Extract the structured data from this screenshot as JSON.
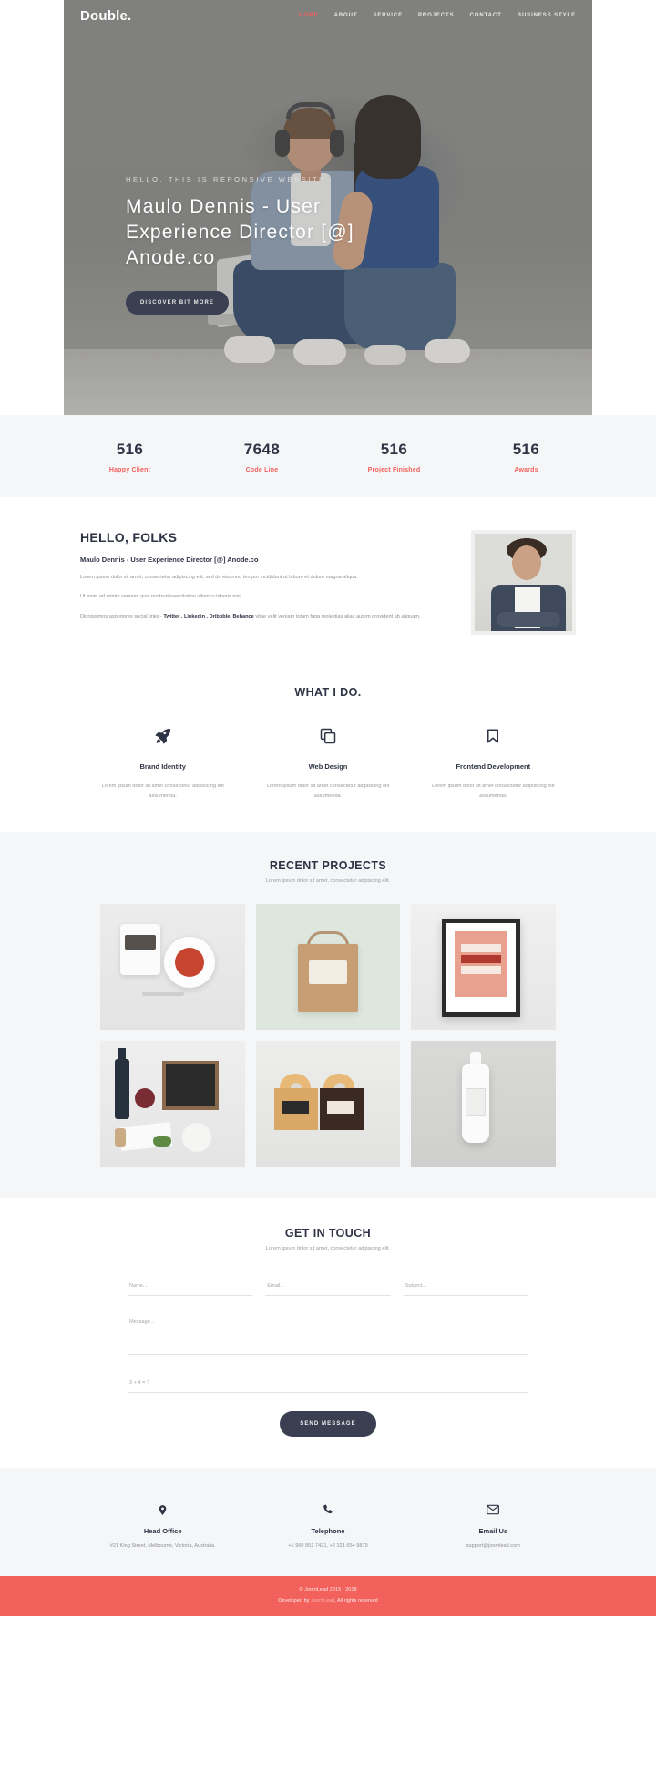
{
  "header": {
    "brand": "Double.",
    "nav": [
      {
        "label": "HOME",
        "active": true
      },
      {
        "label": "ABOUT",
        "active": false
      },
      {
        "label": "SERVICE",
        "active": false
      },
      {
        "label": "PROJECTS",
        "active": false
      },
      {
        "label": "CONTACT",
        "active": false
      },
      {
        "label": "BUSINESS STYLE",
        "active": false
      }
    ],
    "accent_color": "#f2615c",
    "nav_color": "#e9e9e9"
  },
  "hero": {
    "kicker": "HELLO, THIS IS REPONSIVE WEBSITE",
    "title": "Maulo Dennis - User Experience Director [@] Anode.co",
    "button": "DISCOVER BIT MORE"
  },
  "stats": {
    "items": [
      {
        "number": "516",
        "label": "Happy Client"
      },
      {
        "number": "7648",
        "label": "Code Line"
      },
      {
        "number": "516",
        "label": "Project Finished"
      },
      {
        "number": "516",
        "label": "Awards"
      }
    ],
    "label_color": "#f2615c"
  },
  "about": {
    "heading": "HELLO, FOLKS",
    "subheading": "Maulo Dennis - User Experience Director [@] Anode.co",
    "para1": "Lorem ipsum dolor sit amet, consectetur adipiscing elit, sed do eiusmod tempor incididunt ut labore et dolore magna aliqua.",
    "para2": "Ut enim ad minim veniam, quis nostrud exercitation ullamco laboris nisi.",
    "para3_pre": "Dignissimos asperiores social links - ",
    "para3_links": "Twitter , Linkedin , Dribbble, Behance",
    "para3_post": " vitae velit veniam totam fuga molestias alias autem provident ab aliquam."
  },
  "services": {
    "title": "WHAT I DO.",
    "items": [
      {
        "icon": "rocket-icon",
        "name": "Brand Identity",
        "desc": "Lorem ipsum dolor sit amet consectetur adipisicing elit assumenda."
      },
      {
        "icon": "copy-layers-icon",
        "name": "Web Design",
        "desc": "Lorem ipsum dolor sit amet consectetur adipisicing elit assumenda."
      },
      {
        "icon": "bookmark-icon",
        "name": "Frontend Development",
        "desc": "Lorem ipsum dolor sit amet consectetur adipisicing elit assumenda."
      }
    ]
  },
  "projects": {
    "title": "RECENT PROJECTS",
    "subtitle": "Lorem ipsum dolor sit amet, consectetur adipiscing elit.",
    "items": [
      {
        "name": "coffee-cup-and-soup-bowl-mockup"
      },
      {
        "name": "paper-shopping-bag-mockup"
      },
      {
        "name": "framed-poster-psd-mockup"
      },
      {
        "name": "wine-bottle-and-chalkboard-mockup"
      },
      {
        "name": "donut-boxes-packaging-mockup"
      },
      {
        "name": "white-bottle-mockup"
      }
    ]
  },
  "contact": {
    "title": "GET IN TOUCH",
    "subtitle": "Lorem ipsum dolor sit amet, consectetur adipiscing elit.",
    "fields": {
      "name_placeholder": "Name...",
      "email_placeholder": "Email...",
      "subject_placeholder": "Subject...",
      "message_placeholder": "Message...",
      "captcha_placeholder": "3 + 4 = ?"
    },
    "send_label": "SEND MESSAGE"
  },
  "footer": {
    "columns": [
      {
        "icon": "map-pin-icon",
        "title": "Head Office",
        "text": "#21 King Street, Melbourne, Victoria, Australia."
      },
      {
        "icon": "phone-icon",
        "title": "Telephone",
        "text": "+1 960 852 7421, +2 321 654 9879"
      },
      {
        "icon": "envelope-icon",
        "title": "Email Us",
        "text": "support@joomlead.com"
      }
    ],
    "copyright_line1": "© JoomLead 2015 - 2018",
    "copyright_pre": "Developed by ",
    "copyright_link": "JoomLead",
    "copyright_post": ", All rights reserved",
    "bar_color": "#f2615c"
  }
}
